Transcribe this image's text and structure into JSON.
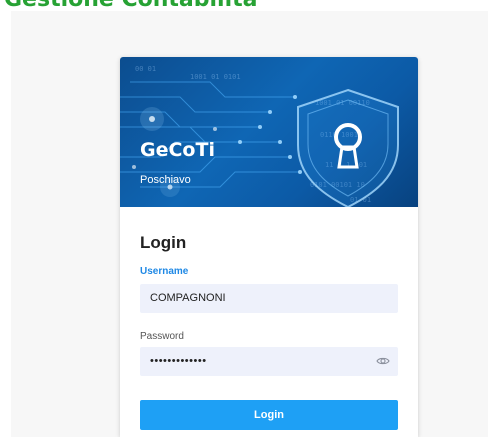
{
  "page": {
    "heading": "Gestione Contabilità"
  },
  "banner": {
    "title": "GeCoTi",
    "subtitle": "Poschiavo"
  },
  "form": {
    "title": "Login",
    "username_label": "Username",
    "username_value": "COMPAGNONI",
    "password_label": "Password",
    "password_value": "•••••••••••••",
    "submit_label": "Login"
  },
  "icons": {
    "banner_art": "shield-keyhole-icon",
    "password_toggle": "eye-icon"
  },
  "colors": {
    "heading": "#27a234",
    "banner": "#0f66b4",
    "accent": "#1e88e5",
    "button": "#1ea0f5",
    "input_bg": "#eef1fb"
  }
}
